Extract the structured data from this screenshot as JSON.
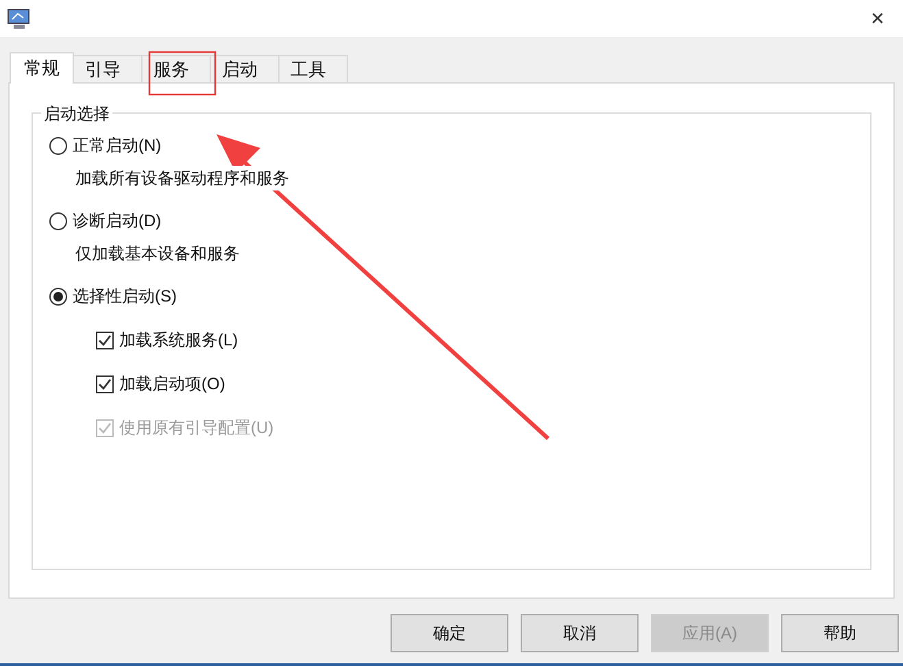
{
  "window": {
    "close": "✕"
  },
  "tabs": [
    {
      "label": "常规",
      "selected": true
    },
    {
      "label": "引导",
      "selected": false
    },
    {
      "label": "服务",
      "selected": false
    },
    {
      "label": "启动",
      "selected": false
    },
    {
      "label": "工具",
      "selected": false
    }
  ],
  "group": {
    "title": "启动选择",
    "options": [
      {
        "label": "正常启动(N)",
        "description": "加载所有设备驱动程序和服务",
        "selected": false
      },
      {
        "label": "诊断启动(D)",
        "description": "仅加载基本设备和服务",
        "selected": false
      },
      {
        "label": "选择性启动(S)",
        "selected": true,
        "checkboxes": [
          {
            "label": "加载系统服务(L)",
            "checked": true,
            "disabled": false
          },
          {
            "label": "加载启动项(O)",
            "checked": true,
            "disabled": false
          },
          {
            "label": "使用原有引导配置(U)",
            "checked": true,
            "disabled": true
          }
        ]
      }
    ]
  },
  "buttons": [
    {
      "label": "确定",
      "disabled": false
    },
    {
      "label": "取消",
      "disabled": false
    },
    {
      "label": "应用(A)",
      "disabled": true
    },
    {
      "label": "帮助",
      "disabled": false
    }
  ]
}
